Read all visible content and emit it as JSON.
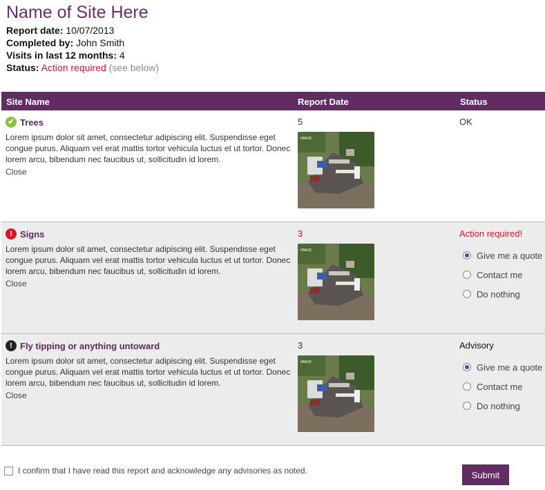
{
  "site": {
    "title": "Name of Site Here",
    "report_date_label": "Report date:",
    "report_date": "10/07/2013",
    "completed_by_label": "Completed by:",
    "completed_by": "John Smith",
    "visits_label": "Visits in last 12 months:",
    "visits": "4",
    "status_label": "Status:",
    "status_value": "Action required",
    "status_note": "(see below)"
  },
  "table": {
    "headers": [
      "Site Name",
      "Report Date",
      "Status"
    ],
    "rows": [
      {
        "icon": "check-icon",
        "title": "Trees",
        "description": "Lorem ipsum dolor sit amet, consectetur adipiscing elit. Suspendisse eget congue purus. Aliquam vel erat mattis tortor vehicula luctus et ut tortor. Donec lorem arcu, bibendum nec faucibus ut, sollicitudin id lorem.",
        "close_label": "Close",
        "report_value": "5",
        "status": "OK"
      },
      {
        "icon": "alert-icon",
        "title": "Signs",
        "description": "Lorem ipsum dolor sit amet, consectetur adipiscing elit. Suspendisse eget congue purus. Aliquam vel erat mattis tortor vehicula luctus et ut tortor. Donec lorem arcu, bibendum nec faucibus ut, sollicitudin id lorem.",
        "close_label": "Close",
        "report_value": "3",
        "status": "Action required!",
        "options": [
          "Give me a quote",
          "Contact me",
          "Do nothing"
        ],
        "selected": "Give me a quote"
      },
      {
        "icon": "warning-icon",
        "title": "Fly tipping or anything untoward",
        "description": "Lorem ipsum dolor sit amet, consectetur adipiscing elit. Suspendisse eget congue purus. Aliquam vel erat mattis tortor vehicula luctus et ut tortor. Donec lorem arcu, bibendum nec faucibus ut, sollicitudin id lorem.",
        "close_label": "Close",
        "report_value": "3",
        "status": "Advisory",
        "options": [
          "Give me a quote",
          "Contact me",
          "Do nothing"
        ],
        "selected": "Give me a quote"
      }
    ]
  },
  "footer": {
    "confirm_label": "I confirm that I have read this report and acknowledge any advisories as noted.",
    "submit_label": "Submit"
  },
  "colors": {
    "brand": "#612c62",
    "alert": "#d0182a",
    "ok": "#8dc33b"
  }
}
